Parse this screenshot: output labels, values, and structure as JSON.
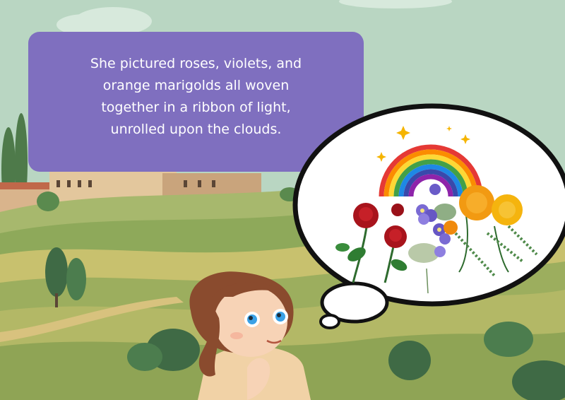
{
  "caption": {
    "text": "She pictured roses, violets, and\norange marigolds all woven\ntogether in a ribbon of light,\nunrolled upon the clouds."
  },
  "colors": {
    "caption_bg": "#7f6fbf",
    "sky": "#b9d6c2",
    "hills": "#8ea95a",
    "thought_bubble_fill": "#ffffff",
    "thought_bubble_stroke": "#111111"
  },
  "illustration": {
    "background": "tuscan-hills-landscape",
    "character": "girl-thinking",
    "thought_contents": [
      "rainbow",
      "sparkles",
      "roses",
      "violets",
      "marigolds"
    ]
  }
}
